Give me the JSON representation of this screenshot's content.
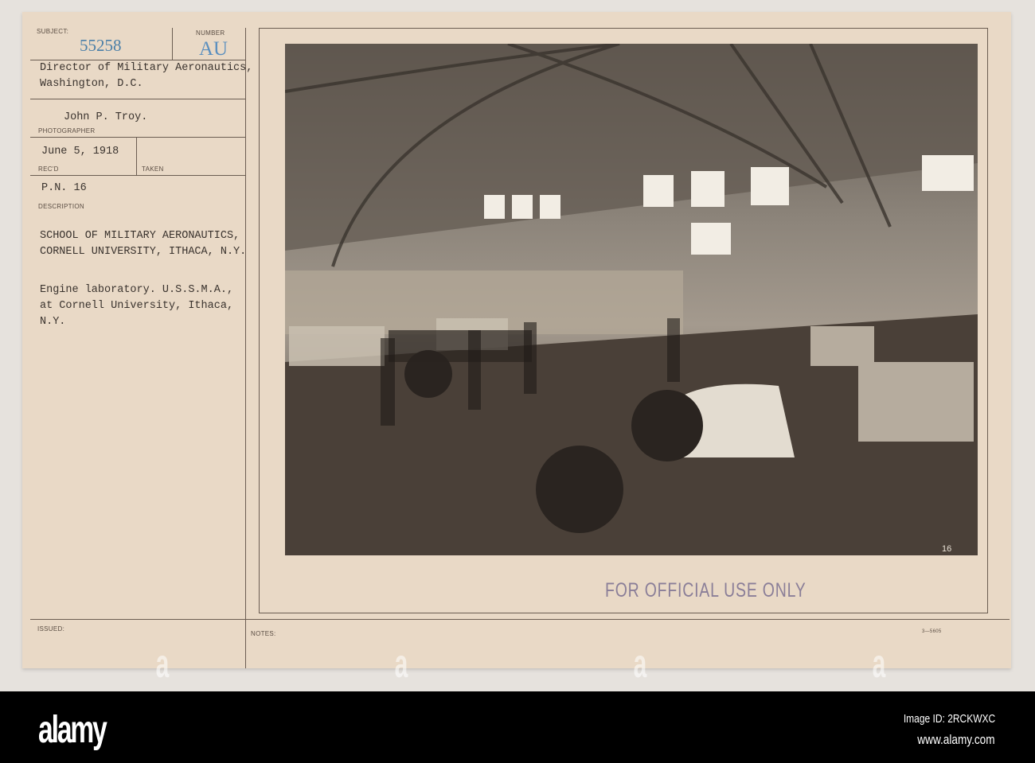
{
  "card": {
    "subject_label": "SUBJECT:",
    "subject_number": "55258",
    "number_label": "NUMBER",
    "number_value": "AU",
    "source_line1": "Director of Military Aeronautics,",
    "source_line2": "Washington, D.C.",
    "photographer_name": "John P. Troy.",
    "photographer_label": "PHOTOGRAPHER",
    "received_date": "June 5, 1918",
    "received_label": "REC'D",
    "taken_label": "TAKEN",
    "pn": "P.N. 16",
    "description_label": "DESCRIPTION",
    "description_title_1": "SCHOOL OF MILITARY AERONAUTICS,",
    "description_title_2": "CORNELL UNIVERSITY, ITHACA, N.Y.",
    "description_body_1": "Engine laboratory. U.S.S.M.A.,",
    "description_body_2": "at Cornell University, Ithaca,",
    "description_body_3": "N.Y.",
    "photo_number": "16",
    "stamp": "FOR OFFICIAL USE ONLY",
    "issued_label": "ISSUED:",
    "notes_label": "NOTES:",
    "form_code": "3—5605"
  },
  "footer": {
    "logo": "alamy",
    "image_id": "Image ID: 2RCKWXC",
    "url": "www.alamy.com"
  },
  "colors": {
    "card": "#e9d9c6",
    "ink_blue": "#4a7fa8",
    "stamp": "#8a7e98"
  }
}
